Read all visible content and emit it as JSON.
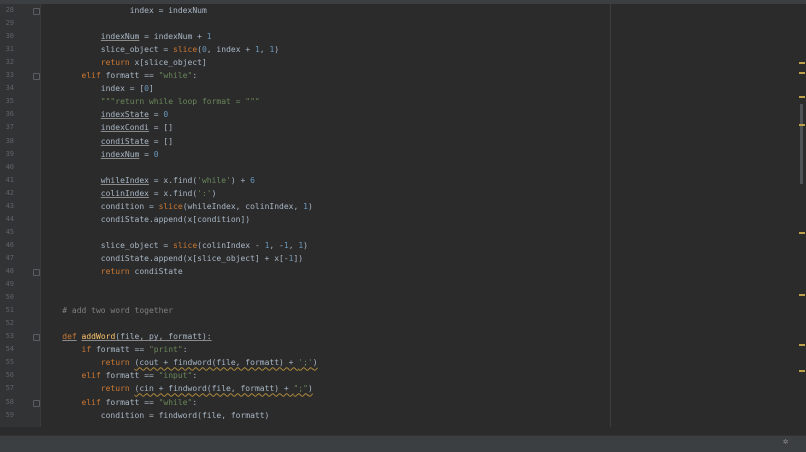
{
  "editor": {
    "lines": [
      {
        "num": "28",
        "indent": "                  ",
        "tokens": [
          {
            "t": "index = indexNum"
          }
        ]
      },
      {
        "num": "29",
        "indent": "",
        "tokens": []
      },
      {
        "num": "30",
        "indent": "            ",
        "tokens": [
          {
            "t": "indexNum",
            "c": "u"
          },
          {
            "t": " = indexNum + "
          },
          {
            "t": "1",
            "c": "num"
          }
        ]
      },
      {
        "num": "31",
        "indent": "            ",
        "tokens": [
          {
            "t": "slice_object = "
          },
          {
            "t": "slice",
            "c": "kw"
          },
          {
            "t": "("
          },
          {
            "t": "0",
            "c": "num"
          },
          {
            "t": ", index + "
          },
          {
            "t": "1",
            "c": "num"
          },
          {
            "t": ", "
          },
          {
            "t": "1",
            "c": "num"
          },
          {
            "t": ")"
          }
        ]
      },
      {
        "num": "32",
        "indent": "            ",
        "tokens": [
          {
            "t": "return",
            "c": "kw"
          },
          {
            "t": " x[slice_object]"
          }
        ]
      },
      {
        "num": "33",
        "indent": "        ",
        "tokens": [
          {
            "t": "elif",
            "c": "kw"
          },
          {
            "t": " formatt == "
          },
          {
            "t": "\"while\"",
            "c": "str"
          },
          {
            "t": ":"
          }
        ]
      },
      {
        "num": "34",
        "indent": "            ",
        "tokens": [
          {
            "t": "index = ["
          },
          {
            "t": "0",
            "c": "num"
          },
          {
            "t": "]"
          }
        ]
      },
      {
        "num": "35",
        "indent": "            ",
        "tokens": [
          {
            "t": "\"\"\"return while loop format = \"\"\"",
            "c": "str"
          }
        ]
      },
      {
        "num": "36",
        "indent": "            ",
        "tokens": [
          {
            "t": "indexState",
            "c": "u"
          },
          {
            "t": " = "
          },
          {
            "t": "0",
            "c": "num"
          }
        ]
      },
      {
        "num": "37",
        "indent": "            ",
        "tokens": [
          {
            "t": "indexCondi",
            "c": "u"
          },
          {
            "t": " = []"
          }
        ]
      },
      {
        "num": "38",
        "indent": "            ",
        "tokens": [
          {
            "t": "condiState",
            "c": "u"
          },
          {
            "t": " = []"
          }
        ]
      },
      {
        "num": "39",
        "indent": "            ",
        "tokens": [
          {
            "t": "indexNum",
            "c": "u"
          },
          {
            "t": " = "
          },
          {
            "t": "0",
            "c": "num"
          }
        ]
      },
      {
        "num": "40",
        "indent": "",
        "tokens": []
      },
      {
        "num": "41",
        "indent": "            ",
        "tokens": [
          {
            "t": "whileIndex",
            "c": "u"
          },
          {
            "t": " = x.find("
          },
          {
            "t": "'while'",
            "c": "str"
          },
          {
            "t": ") + "
          },
          {
            "t": "6",
            "c": "num"
          }
        ]
      },
      {
        "num": "42",
        "indent": "            ",
        "tokens": [
          {
            "t": "colinIndex",
            "c": "u"
          },
          {
            "t": " = x.find("
          },
          {
            "t": "':'",
            "c": "str"
          },
          {
            "t": ")"
          }
        ]
      },
      {
        "num": "43",
        "indent": "            ",
        "tokens": [
          {
            "t": "condition = "
          },
          {
            "t": "slice",
            "c": "kw"
          },
          {
            "t": "(whileIndex, colinIndex, "
          },
          {
            "t": "1",
            "c": "num"
          },
          {
            "t": ")"
          }
        ]
      },
      {
        "num": "44",
        "indent": "            ",
        "tokens": [
          {
            "t": "condiState.append(x[condition])"
          }
        ]
      },
      {
        "num": "45",
        "indent": "",
        "tokens": []
      },
      {
        "num": "46",
        "indent": "            ",
        "tokens": [
          {
            "t": "slice_object = "
          },
          {
            "t": "slice",
            "c": "kw"
          },
          {
            "t": "(colinIndex - "
          },
          {
            "t": "1",
            "c": "num"
          },
          {
            "t": ", -"
          },
          {
            "t": "1",
            "c": "num"
          },
          {
            "t": ", "
          },
          {
            "t": "1",
            "c": "num"
          },
          {
            "t": ")"
          }
        ]
      },
      {
        "num": "47",
        "indent": "            ",
        "tokens": [
          {
            "t": "condiState.append(x[slice_object] + x[-"
          },
          {
            "t": "1",
            "c": "num"
          },
          {
            "t": "])"
          }
        ]
      },
      {
        "num": "48",
        "indent": "            ",
        "tokens": [
          {
            "t": "return",
            "c": "kw"
          },
          {
            "t": " condiState"
          }
        ]
      },
      {
        "num": "49",
        "indent": "",
        "tokens": []
      },
      {
        "num": "50",
        "indent": "",
        "tokens": []
      },
      {
        "num": "51",
        "indent": "    ",
        "tokens": [
          {
            "t": "# add two word together",
            "c": "cm"
          }
        ]
      },
      {
        "num": "52",
        "indent": "",
        "tokens": []
      },
      {
        "num": "53",
        "indent": "    ",
        "tokens": [
          {
            "t": "def",
            "c": "kw u"
          },
          {
            "t": " "
          },
          {
            "t": "addWord",
            "c": "fn u"
          },
          {
            "t": "(file, py, formatt):",
            "c": "u"
          }
        ]
      },
      {
        "num": "54",
        "indent": "        ",
        "tokens": [
          {
            "t": "if",
            "c": "kw"
          },
          {
            "t": " formatt == "
          },
          {
            "t": "\"print\"",
            "c": "str"
          },
          {
            "t": ":"
          }
        ]
      },
      {
        "num": "55",
        "indent": "            ",
        "tokens": [
          {
            "t": "return",
            "c": "kw"
          },
          {
            "t": " "
          },
          {
            "t": "(cout + findword(file, formatt) + ",
            "c": "squig"
          },
          {
            "t": "';'",
            "c": "str squig"
          },
          {
            "t": ")",
            "c": "squig"
          }
        ]
      },
      {
        "num": "56",
        "indent": "        ",
        "tokens": [
          {
            "t": "elif",
            "c": "kw"
          },
          {
            "t": " formatt == "
          },
          {
            "t": "\"input\"",
            "c": "str"
          },
          {
            "t": ":"
          }
        ]
      },
      {
        "num": "57",
        "indent": "            ",
        "tokens": [
          {
            "t": "return",
            "c": "kw"
          },
          {
            "t": " "
          },
          {
            "t": "(cin + findword(file, formatt) + ",
            "c": "squig"
          },
          {
            "t": "\";\"",
            "c": "str squig"
          },
          {
            "t": ")",
            "c": "squig"
          }
        ]
      },
      {
        "num": "58",
        "indent": "        ",
        "tokens": [
          {
            "t": "elif",
            "c": "kw"
          },
          {
            "t": " formatt == "
          },
          {
            "t": "\"while\"",
            "c": "str"
          },
          {
            "t": ":"
          }
        ]
      },
      {
        "num": "59",
        "indent": "            ",
        "tokens": [
          {
            "t": "condition = findword(file, formatt)"
          }
        ]
      }
    ],
    "fold_lines": [
      "28",
      "33",
      "48",
      "53",
      "58"
    ]
  },
  "statusbar": {
    "icon": "settings-icon"
  },
  "colors": {
    "background": "#2b2b2b",
    "keyword": "#cc7832",
    "string": "#6a8759",
    "number": "#6897bb",
    "comment": "#808080",
    "function": "#ffc66d",
    "text": "#a9b7c6"
  }
}
